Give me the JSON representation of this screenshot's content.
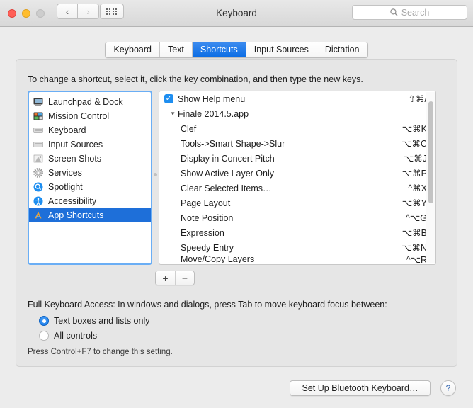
{
  "window": {
    "title": "Keyboard",
    "traffic_lights": [
      "close",
      "minimize",
      "zoom-disabled"
    ],
    "back_label": "‹",
    "forward_label": "›"
  },
  "search": {
    "placeholder": "Search",
    "icon": "search-icon"
  },
  "tabs": [
    {
      "label": "Keyboard",
      "active": false
    },
    {
      "label": "Text",
      "active": false
    },
    {
      "label": "Shortcuts",
      "active": true
    },
    {
      "label": "Input Sources",
      "active": false
    },
    {
      "label": "Dictation",
      "active": false
    }
  ],
  "panel": {
    "hint": "To change a shortcut, select it, click the key combination, and then type the new keys."
  },
  "sidebar": {
    "items": [
      {
        "label": "Launchpad & Dock",
        "icon": "display-icon",
        "color": "#3c3c3c",
        "selected": false
      },
      {
        "label": "Mission Control",
        "icon": "mission-control-icon",
        "color": "#2f7d32",
        "selected": false
      },
      {
        "label": "Keyboard",
        "icon": "keyboard-icon",
        "color": "#d6d6d6",
        "selected": false
      },
      {
        "label": "Input Sources",
        "icon": "keyboard-icon",
        "color": "#d6d6d6",
        "selected": false
      },
      {
        "label": "Screen Shots",
        "icon": "screenshot-icon",
        "color": "#8c8c8c",
        "selected": false
      },
      {
        "label": "Services",
        "icon": "gear-icon",
        "color": "#9a9a9a",
        "selected": false
      },
      {
        "label": "Spotlight",
        "icon": "spotlight-icon",
        "color": "#1e8ef0",
        "selected": false
      },
      {
        "label": "Accessibility",
        "icon": "accessibility-icon",
        "color": "#1e8ef0",
        "selected": false
      },
      {
        "label": "App Shortcuts",
        "icon": "launchpad-icon",
        "color": "#f0a030",
        "selected": true
      }
    ]
  },
  "shortcuts": {
    "rows": [
      {
        "kind": "checkbox",
        "label": "Show Help menu",
        "key": "⇧⌘/",
        "checked": true
      },
      {
        "kind": "group",
        "label": "Finale 2014.5.app",
        "key": "",
        "expanded": true
      },
      {
        "kind": "item",
        "label": "Clef",
        "key": "⌥⌘K"
      },
      {
        "kind": "item",
        "label": "Tools->Smart Shape->Slur",
        "key": "⌥⌘C"
      },
      {
        "kind": "item",
        "label": "Display in Concert Pitch",
        "key": "⌥⌘J"
      },
      {
        "kind": "item",
        "label": "Show Active Layer Only",
        "key": "⌥⌘P"
      },
      {
        "kind": "item",
        "label": "Clear Selected Items…",
        "key": "^⌘X"
      },
      {
        "kind": "item",
        "label": "Page Layout",
        "key": "⌥⌘Y"
      },
      {
        "kind": "item",
        "label": "Note Position",
        "key": "^⌥G"
      },
      {
        "kind": "item",
        "label": "Expression",
        "key": "⌥⌘B"
      },
      {
        "kind": "item",
        "label": "Speedy Entry",
        "key": "⌥⌘N"
      },
      {
        "kind": "clipped",
        "label": "Move/Copy Layers",
        "key": "^⌥R"
      }
    ],
    "disclosure_glyph": "▼",
    "check_glyph": "✓"
  },
  "list_buttons": {
    "add_label": "+",
    "remove_label": "−"
  },
  "full_keyboard_access": {
    "title": "Full Keyboard Access: In windows and dialogs, press Tab to move keyboard focus between:",
    "options": [
      {
        "label": "Text boxes and lists only",
        "selected": true
      },
      {
        "label": "All controls",
        "selected": false
      }
    ],
    "note": "Press Control+F7 to change this setting."
  },
  "footer": {
    "bluetooth_button": "Set Up Bluetooth Keyboard…",
    "help_button": "?"
  },
  "colors": {
    "accent_blue": "#1e6fd9",
    "tab_blue": "#0a6ce4",
    "window_bg": "#ececec",
    "panel_bg": "#e6e6e6"
  }
}
